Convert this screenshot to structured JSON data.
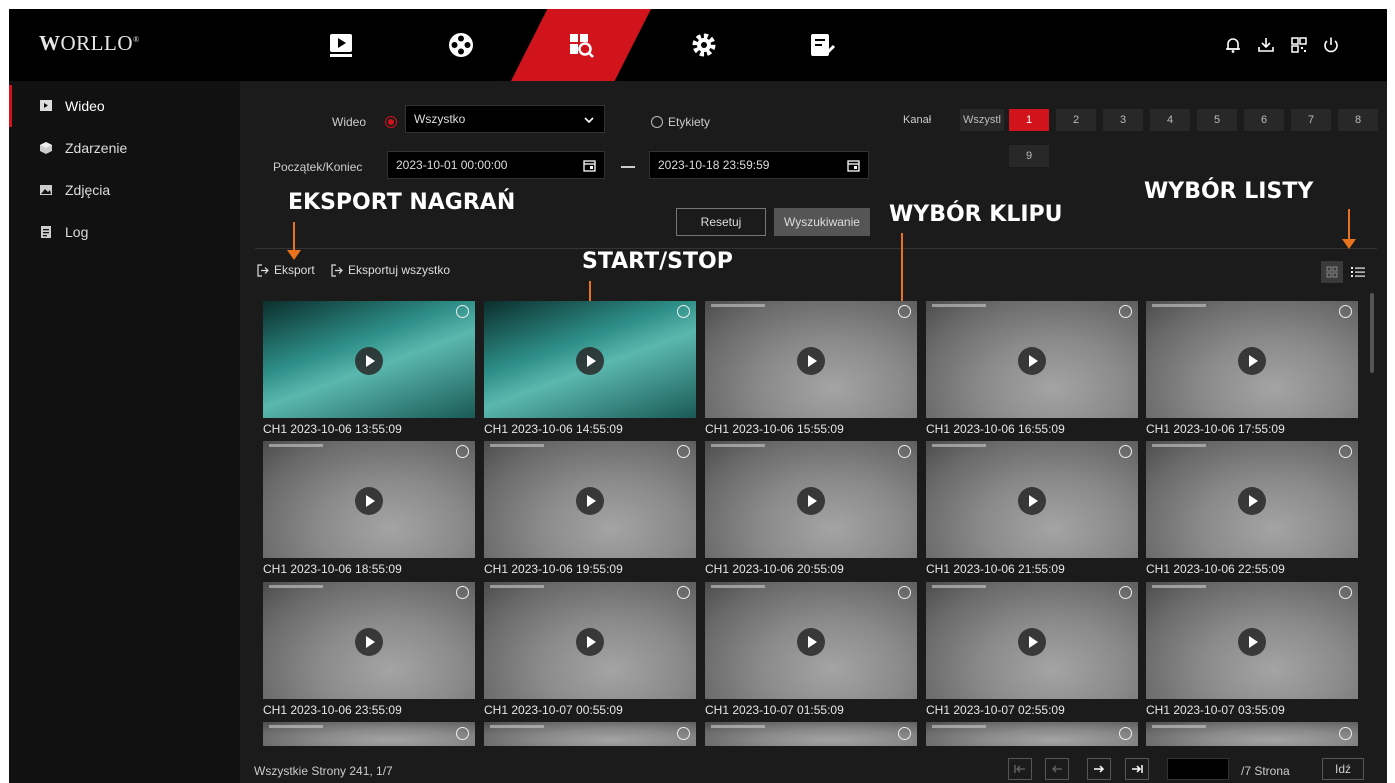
{
  "brand": {
    "logo": "ORLLO",
    "logo_mark": "®"
  },
  "top_nav": [
    {
      "name": "playback-icon"
    },
    {
      "name": "film-reel-icon"
    },
    {
      "name": "search-playback-icon",
      "active": true
    },
    {
      "name": "gear-icon"
    },
    {
      "name": "maintenance-icon"
    }
  ],
  "top_actions": [
    "bell-icon",
    "download-icon",
    "qr-code-icon",
    "power-icon"
  ],
  "sidebar": {
    "items": [
      {
        "label": "Wideo",
        "icon": "video-icon",
        "active": true
      },
      {
        "label": "Zdarzenie",
        "icon": "cube-icon"
      },
      {
        "label": "Zdjęcia",
        "icon": "image-icon"
      },
      {
        "label": "Log",
        "icon": "document-icon"
      }
    ]
  },
  "filters": {
    "video_label": "Wideo",
    "video_select_value": "Wszystko",
    "tags_label": "Etykiety",
    "channel_label": "Kanał",
    "channel_all": "Wszystl",
    "channels": [
      "1",
      "2",
      "3",
      "4",
      "5",
      "6",
      "7",
      "8",
      "9"
    ],
    "active_channel": "1",
    "range_label": "Początek/Koniec",
    "start": "2023-10-01 00:00:00",
    "end": "2023-10-18 23:59:59",
    "reset_label": "Resetuj",
    "search_label": "Wyszukiwanie"
  },
  "annotations": {
    "export": "EKSPORT NAGRAŃ",
    "startstop": "START/STOP",
    "clip": "WYBÓR KLIPU",
    "list": "WYBÓR LISTY"
  },
  "actions": {
    "export_label": "Eksport",
    "export_all_label": "Eksportuj wszystko"
  },
  "clips": [
    "CH1 2023-10-06 13:55:09",
    "CH1 2023-10-06 14:55:09",
    "CH1 2023-10-06 15:55:09",
    "CH1 2023-10-06 16:55:09",
    "CH1 2023-10-06 17:55:09",
    "CH1 2023-10-06 18:55:09",
    "CH1 2023-10-06 19:55:09",
    "CH1 2023-10-06 20:55:09",
    "CH1 2023-10-06 21:55:09",
    "CH1 2023-10-06 22:55:09",
    "CH1 2023-10-06 23:55:09",
    "CH1 2023-10-07 00:55:09",
    "CH1 2023-10-07 01:55:09",
    "CH1 2023-10-07 02:55:09",
    "CH1 2023-10-07 03:55:09"
  ],
  "pagination": {
    "summary": "Wszystkie Strony 241, 1/7",
    "page_suffix": "/7 Strona",
    "go_label": "Idź",
    "page_input_value": ""
  }
}
